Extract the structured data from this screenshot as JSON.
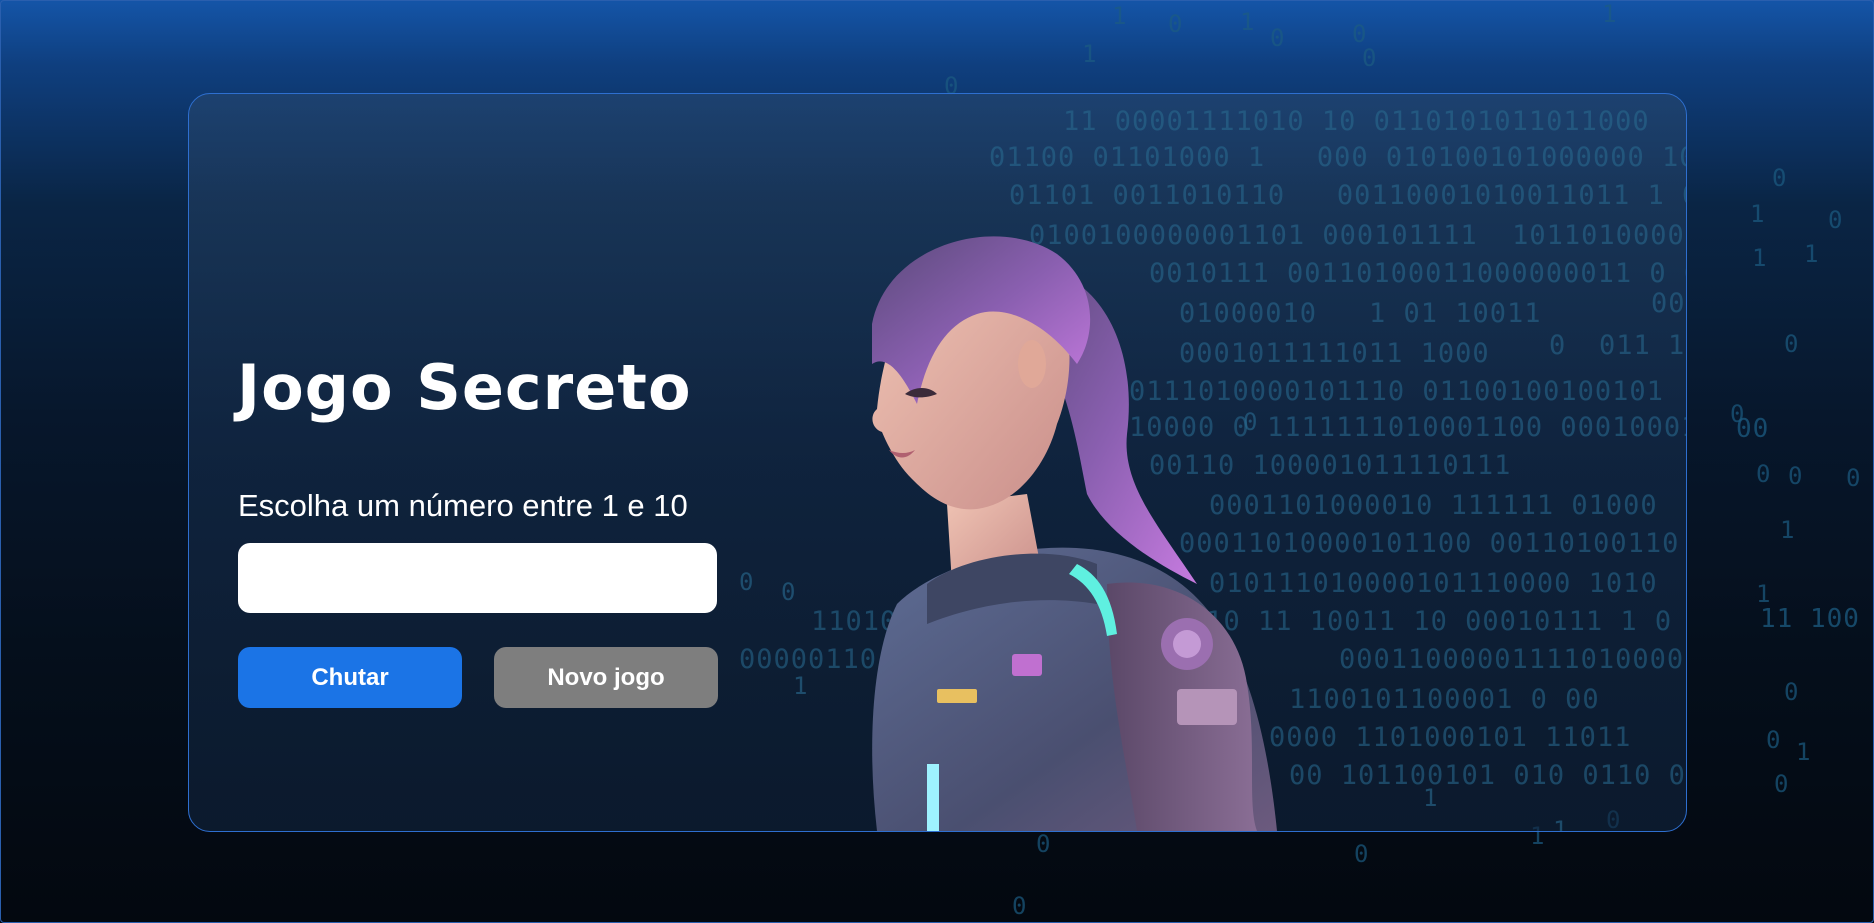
{
  "game": {
    "title": "Jogo Secreto",
    "instruction": "Escolha um número entre 1 e 10",
    "input_value": "",
    "guess_button_label": "Chutar",
    "new_game_button_label": "Novo jogo"
  },
  "colors": {
    "background_top": "#1455a8",
    "background_bottom": "#03080f",
    "card_border": "#2e6fd0",
    "guess_button": "#1b74e6",
    "new_game_button": "#7e7e7e",
    "binary_text": "#2a6d93"
  },
  "decoration": {
    "avatar": "space-suit-girl-illustration",
    "background_pattern": "falling-binary-digits"
  }
}
